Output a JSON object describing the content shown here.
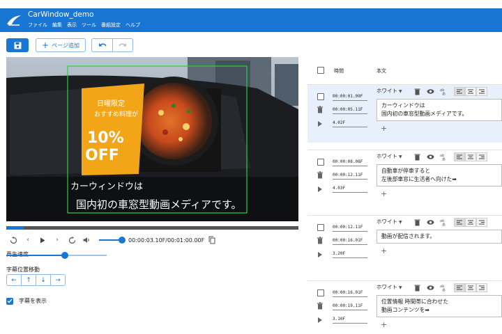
{
  "app": {
    "title": "CarWindow_demo"
  },
  "menu": [
    "ファイル",
    "編集",
    "表示",
    "ツール",
    "番組設定",
    "ヘルプ"
  ],
  "toolbar": {
    "add_page_label": "ページ追加"
  },
  "player": {
    "timecode": "00:00:03.10F/00:01:00.00F",
    "progress": 0.06,
    "overlay": {
      "banner_line1": "日曜限定",
      "banner_line2": "おすすめ料理が",
      "discount_pct": "10%",
      "discount_word": "OFF",
      "subtitle_line1": "カーウィンドウは",
      "subtitle_line2": "国内初の車窓型動画メディアです。"
    }
  },
  "speed": {
    "label": "再生速度",
    "value": 0.58
  },
  "position_move": {
    "label": "字幕位置移動",
    "buttons": [
      "←",
      "↑",
      "↓",
      "→"
    ]
  },
  "show_subtitles": {
    "label": "字幕を表示",
    "checked": true
  },
  "list": {
    "time_header": "時間",
    "text_header": "本文",
    "rows": [
      {
        "in": "00:00:01.09F",
        "out": "00:00:05.11F",
        "dur": "4.02F",
        "color": "ホワイト",
        "text1": "カーウィンドウは",
        "text2": "国内初の車窓型動画メディアです。",
        "selected": true
      },
      {
        "in": "00:00:08.08F",
        "out": "00:00:12.11F",
        "dur": "4.03F",
        "color": "ホワイト",
        "text1": "自動車が停車すると",
        "text2": "左後部車窓に生活者へ向けた➡",
        "selected": false
      },
      {
        "in": "00:00:12.11F",
        "out": "00:00:16.01F",
        "dur": "3.20F",
        "color": "ホワイト",
        "text1": "動画が配信されます。",
        "text2": "",
        "selected": false
      },
      {
        "in": "00:00:16.01F",
        "out": "00:00:19.11F",
        "dur": "3.10F",
        "color": "ホワイト",
        "text1": "位置情報 時間帯に合わせた",
        "text2": "動画コンテンツを➡",
        "selected": false
      }
    ]
  },
  "colors": {
    "primary": "#1976d2",
    "selected_row": "#e8f0fc",
    "video_bg": "#2e3238",
    "banner": "#f2a516"
  }
}
